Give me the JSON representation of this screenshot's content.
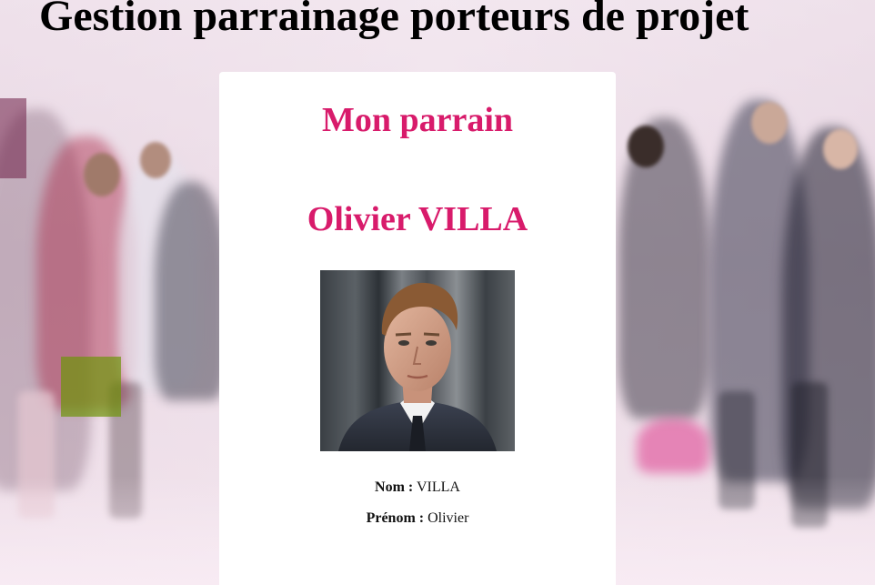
{
  "page": {
    "title": "Gestion parrainage porteurs de projet"
  },
  "card": {
    "heading": "Mon parrain",
    "sponsor_name": "Olivier VILLA",
    "nom_label": "Nom :",
    "nom_value": "VILLA",
    "prenom_label": "Prénom :",
    "prenom_value": "Olivier"
  },
  "colors": {
    "accent": "#d81b6b",
    "card_background": "#ffffff",
    "title": "#000000"
  }
}
